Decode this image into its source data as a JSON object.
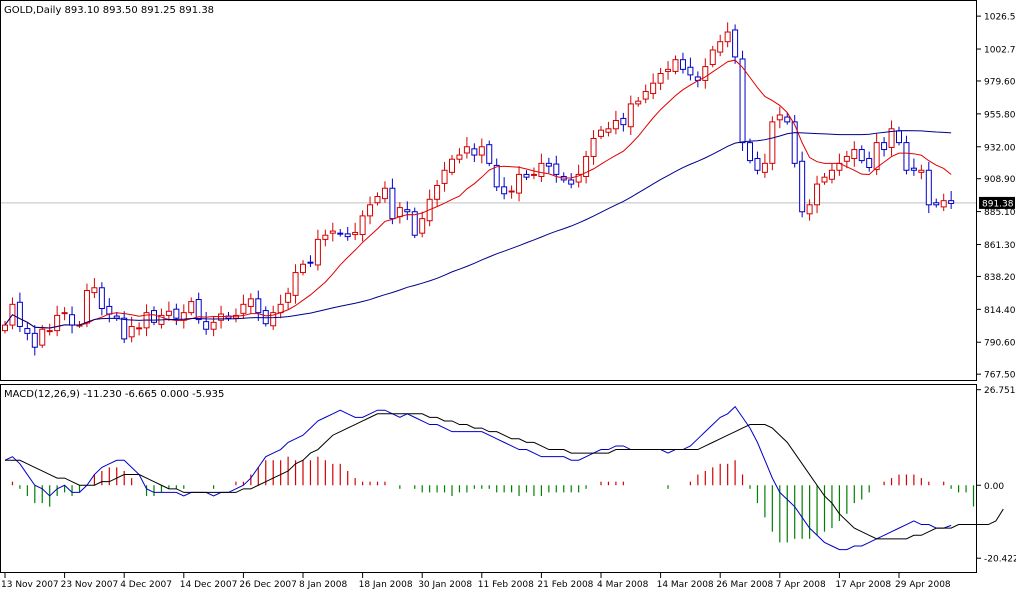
{
  "colors": {
    "background": "#ffffff",
    "frame": "#000000",
    "bull_candle": "#d40000",
    "bear_candle": "#0000c8",
    "ma_fast": "#e00000",
    "ma_slow": "#00008b",
    "macd_line": "#0000c8",
    "signal_line": "#000000",
    "hist_pos": "#d40000",
    "hist_neg": "#008000",
    "price_line": "#c0c0c0",
    "price_tag_bg": "#000000",
    "price_tag_fg": "#ffffff"
  },
  "chart_data": [
    {
      "type": "candlestick",
      "title": "GOLD,Daily  893.10 893.50 891.25 891.38",
      "current_price": 891.38,
      "current_price_label": "891.38",
      "ylim": [
        764.0,
        1036.0
      ],
      "y_ticks": [
        "1026.50",
        "1002.70",
        "979.60",
        "955.80",
        "932.00",
        "908.90",
        "885.10",
        "861.30",
        "838.20",
        "814.40",
        "790.60",
        "767.50"
      ],
      "y_tick_values": [
        1026.5,
        1002.7,
        979.6,
        955.8,
        932.0,
        908.9,
        885.1,
        861.3,
        838.2,
        814.4,
        790.6,
        767.5
      ],
      "x_ticks": [
        "13 Nov 2007",
        "23 Nov 2007",
        "4 Dec 2007",
        "14 Dec 2007",
        "26 Dec 2007",
        "8 Jan 2008",
        "18 Jan 2008",
        "30 Jan 2008",
        "11 Feb 2008",
        "21 Feb 2008",
        "4 Mar 2008",
        "14 Mar 2008",
        "26 Mar 2008",
        "7 Apr 2008",
        "17 Apr 2008",
        "29 Apr 2008"
      ],
      "x_tick_index": [
        0,
        8,
        16,
        24,
        32,
        40,
        48,
        56,
        64,
        72,
        80,
        88,
        96,
        104,
        112,
        120
      ],
      "close": [
        803,
        818,
        802,
        797,
        787,
        800,
        799,
        810,
        812,
        803,
        803,
        828,
        830,
        815,
        811,
        808,
        793,
        802,
        801,
        812,
        805,
        810,
        813,
        808,
        812,
        820,
        807,
        800,
        805,
        811,
        808,
        810,
        818,
        822,
        812,
        804,
        812,
        818,
        826,
        841,
        847,
        848,
        865,
        868,
        871,
        869,
        867,
        870,
        882,
        890,
        896,
        902,
        880,
        888,
        885,
        868,
        880,
        894,
        904,
        915,
        923,
        926,
        932,
        926,
        932,
        920,
        903,
        898,
        900,
        912,
        910,
        912,
        920,
        918,
        912,
        908,
        905,
        912,
        925,
        938,
        944,
        945,
        951,
        948,
        963,
        965,
        972,
        978,
        985,
        988,
        995,
        988,
        984,
        980,
        990,
        1002,
        1008,
        1015,
        997,
        935,
        922,
        915,
        920,
        950,
        955,
        950,
        920,
        885,
        890,
        905,
        910,
        915,
        920,
        925,
        930,
        922,
        917,
        935,
        930,
        945,
        935,
        915,
        915,
        915,
        890,
        890,
        893,
        891
      ]
    },
    {
      "type": "line",
      "title": "MACD(12,26,9) -11.230 -6.665 0.000 -5.935",
      "ylim": [
        -24.0,
        27.5
      ],
      "y_ticks": [
        "26.751",
        "0.00",
        "-20.422"
      ],
      "y_tick_values": [
        26.751,
        0.0,
        -20.422
      ],
      "series": [
        {
          "name": "MACD",
          "type": "line",
          "values": [
            7,
            8,
            6,
            3,
            0,
            -1,
            -3,
            -1,
            0,
            -2,
            -2,
            0,
            3,
            5,
            6,
            7,
            7,
            5,
            3,
            -1,
            -2,
            -2,
            -2,
            -2,
            -3,
            -2,
            -2,
            -2,
            -3,
            -2,
            -2,
            -1,
            0,
            2,
            5,
            8,
            9,
            10,
            12,
            13,
            14,
            16,
            18,
            19,
            20,
            21,
            20,
            19,
            19,
            20,
            21,
            21,
            20,
            19,
            20,
            19,
            18,
            17,
            17,
            16,
            15,
            15,
            15,
            15,
            15,
            14,
            13,
            12,
            11,
            10,
            10,
            9,
            8,
            8,
            8,
            8,
            7,
            7,
            8,
            9,
            10,
            10,
            11,
            11,
            10,
            10,
            10,
            10,
            10,
            9,
            10,
            10,
            11,
            13,
            15,
            17,
            19,
            20,
            22,
            19,
            16,
            12,
            7,
            2,
            -2,
            -4,
            -6,
            -9,
            -12,
            -14,
            -16,
            -17,
            -18,
            -18,
            -17,
            -17,
            -16,
            -15,
            -14,
            -13,
            -12,
            -11,
            -10,
            -11,
            -11,
            -12,
            -12,
            -11.23
          ]
        },
        {
          "name": "Signal",
          "type": "line",
          "values": [
            7,
            7,
            7,
            6,
            5,
            4,
            3,
            2,
            2,
            1,
            0,
            0,
            0,
            1,
            1,
            2,
            3,
            3,
            3,
            2,
            1,
            0,
            -1,
            -1,
            -2,
            -2,
            -2,
            -2,
            -2,
            -2,
            -2,
            -2,
            -1,
            -1,
            0,
            1,
            2,
            3,
            4,
            6,
            7,
            9,
            10,
            12,
            14,
            15,
            16,
            17,
            18,
            19,
            20,
            20,
            20,
            20,
            20,
            20,
            20,
            19,
            19,
            18,
            18,
            17,
            17,
            16,
            16,
            15,
            15,
            14,
            13,
            13,
            12,
            12,
            11,
            10,
            10,
            10,
            9,
            9,
            9,
            9,
            9,
            9,
            10,
            10,
            10,
            10,
            10,
            10,
            10,
            10,
            10,
            10,
            10,
            10,
            11,
            12,
            13,
            14,
            15,
            16,
            17,
            17,
            17,
            16,
            14,
            12,
            9,
            6,
            3,
            0,
            -3,
            -5,
            -8,
            -10,
            -12,
            -13,
            -14,
            -15,
            -15,
            -15,
            -15,
            -15,
            -14,
            -14,
            -13,
            -12,
            -12,
            -12,
            -11,
            -11,
            -11,
            -11,
            -11,
            -10,
            -6.665
          ]
        },
        {
          "name": "OsMA",
          "type": "histogram",
          "values": [
            0,
            1,
            -1,
            -3,
            -5,
            -5,
            -6,
            -3,
            -2,
            -3,
            -2,
            0,
            3,
            4,
            5,
            5,
            4,
            2,
            0,
            -3,
            -3,
            -2,
            -1,
            -1,
            -1,
            0,
            0,
            0,
            -1,
            0,
            0,
            1,
            1,
            3,
            5,
            7,
            7,
            7,
            8,
            7,
            7,
            7,
            8,
            7,
            6,
            6,
            4,
            2,
            1,
            1,
            1,
            1,
            0,
            -1,
            0,
            -1,
            -2,
            -2,
            -2,
            -2,
            -3,
            -2,
            -2,
            -1,
            -1,
            -1,
            -2,
            -2,
            -2,
            -3,
            -2,
            -3,
            -3,
            -2,
            -2,
            -2,
            -2,
            -2,
            -1,
            0,
            1,
            1,
            1,
            1,
            0,
            0,
            0,
            0,
            0,
            -1,
            0,
            0,
            1,
            3,
            4,
            5,
            6,
            6,
            7,
            3,
            -1,
            -5,
            -9,
            -13,
            -16,
            -16,
            -15,
            -15,
            -15,
            -14,
            -13,
            -12,
            -10,
            -8,
            -5,
            -4,
            -2,
            0,
            1,
            2,
            3,
            3,
            3,
            2,
            1,
            0,
            1,
            -1,
            -2,
            -2,
            -5.935
          ]
        }
      ]
    }
  ]
}
